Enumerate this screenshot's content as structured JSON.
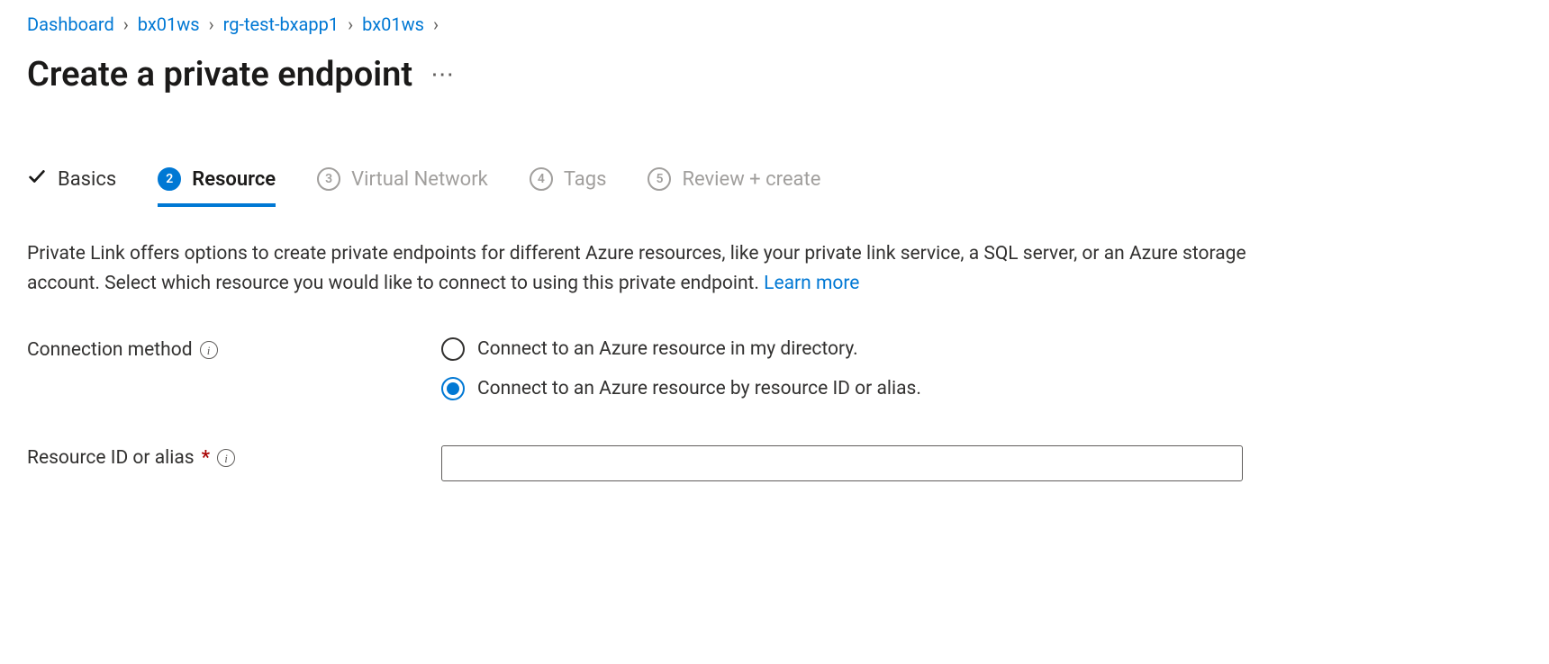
{
  "breadcrumb": {
    "items": [
      {
        "label": "Dashboard"
      },
      {
        "label": "bx01ws"
      },
      {
        "label": "rg-test-bxapp1"
      },
      {
        "label": "bx01ws"
      }
    ]
  },
  "page_title": "Create a private endpoint",
  "tabs": {
    "basics": {
      "label": "Basics"
    },
    "resource": {
      "label": "Resource",
      "step": "2"
    },
    "vnet": {
      "label": "Virtual Network",
      "step": "3"
    },
    "tags": {
      "label": "Tags",
      "step": "4"
    },
    "review": {
      "label": "Review + create",
      "step": "5"
    }
  },
  "description_text": "Private Link offers options to create private endpoints for different Azure resources, like your private link service, a SQL server, or an Azure storage account. Select which resource you would like to connect to using this private endpoint.  ",
  "learn_more": "Learn more",
  "form": {
    "connection_method": {
      "label": "Connection method",
      "option_directory": "Connect to an Azure resource in my directory.",
      "option_resource_id": "Connect to an Azure resource by resource ID or alias."
    },
    "resource_id": {
      "label": "Resource ID or alias",
      "value": ""
    }
  }
}
